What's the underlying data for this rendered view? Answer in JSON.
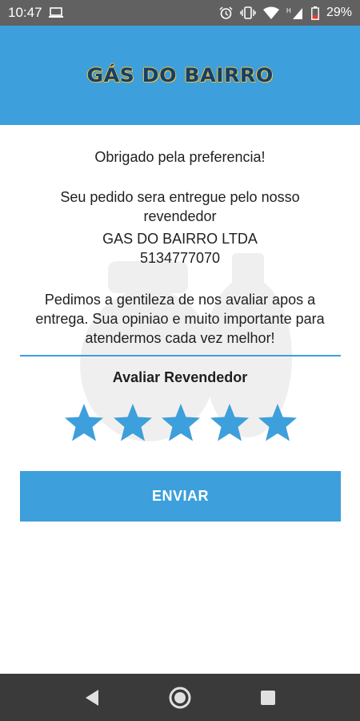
{
  "status_bar": {
    "time": "10:47",
    "battery_percent": "29%",
    "icons": [
      "laptop-icon",
      "alarm-icon",
      "vibrate-icon",
      "wifi-icon",
      "signal-icon",
      "battery-icon"
    ]
  },
  "header": {
    "logo_text": "GÁS DO BAIRRO",
    "background_color": "#3d9fdb"
  },
  "message": {
    "thanks": "Obrigado pela preferencia!",
    "delivery_line1": "Seu pedido sera entregue pelo nosso",
    "delivery_line2": "revendedor",
    "reseller_name": "GAS DO BAIRRO LTDA",
    "reseller_phone": "5134777070",
    "request_line1": "Pedimos a gentileza de nos avaliar apos a",
    "request_line2": "entrega. Sua opiniao e muito importante para",
    "request_line3": "atendermos cada vez melhor!"
  },
  "rating": {
    "title": "Avaliar Revendedor",
    "max_stars": 5,
    "selected_stars": 5,
    "star_color": "#3d9fdb"
  },
  "actions": {
    "send_label": "ENVIAR"
  },
  "nav": {
    "icons": [
      "back-icon",
      "home-icon",
      "recents-icon"
    ]
  }
}
